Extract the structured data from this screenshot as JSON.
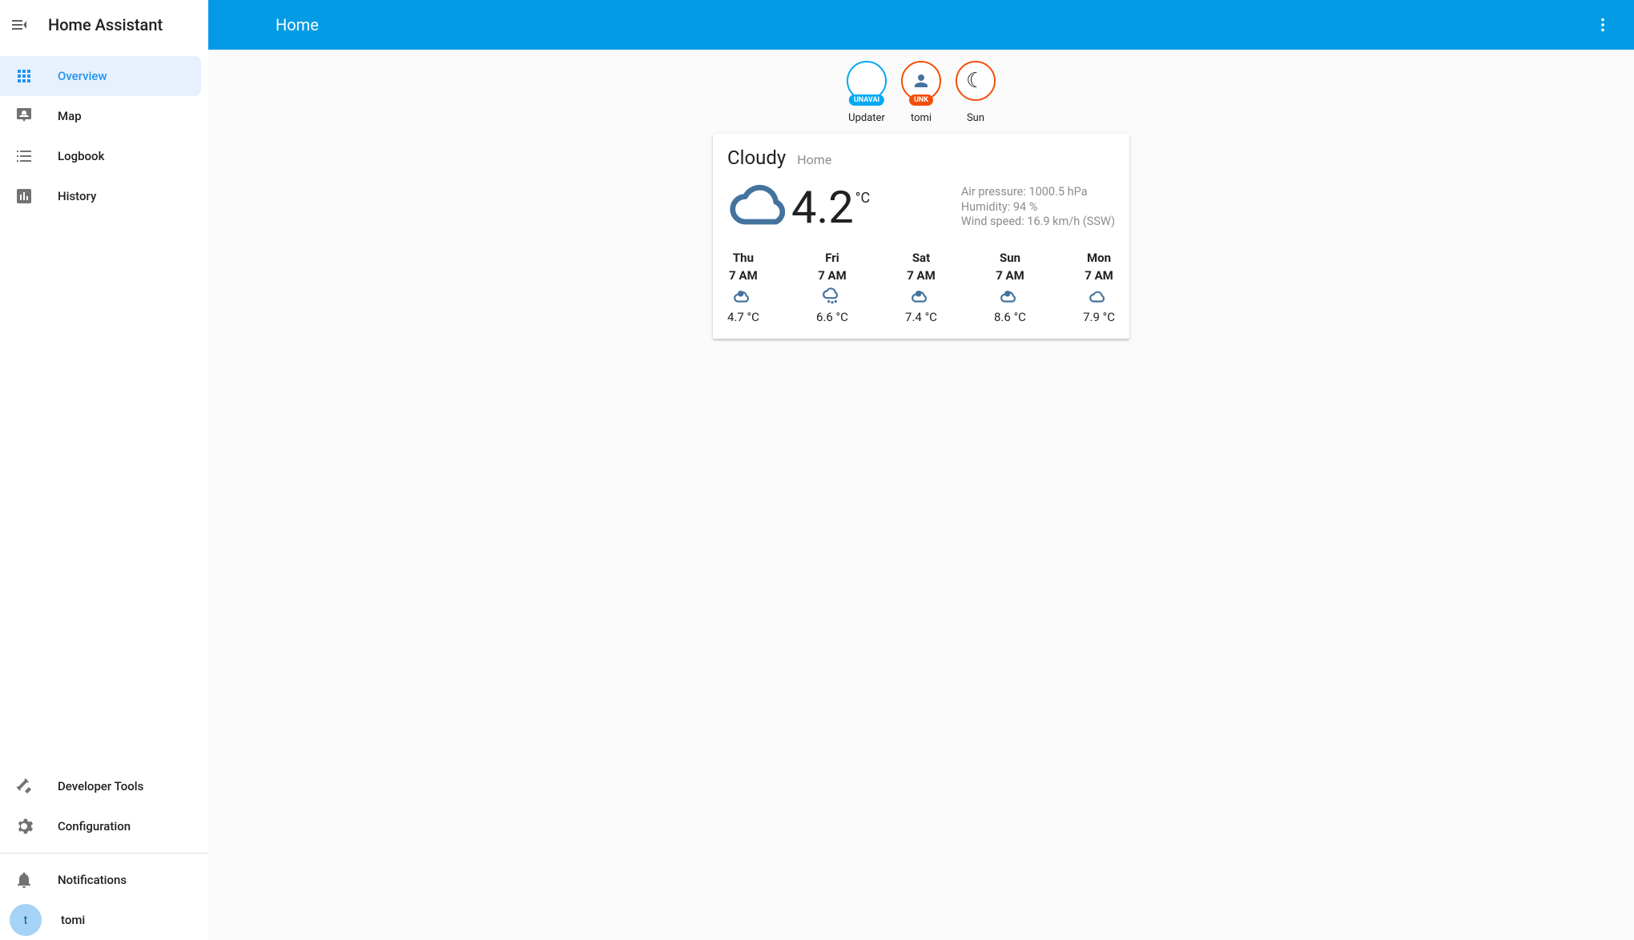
{
  "app": {
    "title": "Home Assistant"
  },
  "sidebar": {
    "items": [
      {
        "id": "overview",
        "label": "Overview",
        "active": true
      },
      {
        "id": "map",
        "label": "Map"
      },
      {
        "id": "logbook",
        "label": "Logbook"
      },
      {
        "id": "history",
        "label": "History"
      }
    ],
    "bottom": [
      {
        "id": "devtools",
        "label": "Developer Tools"
      },
      {
        "id": "config",
        "label": "Configuration"
      }
    ],
    "notifications_label": "Notifications",
    "user": {
      "name": "tomi",
      "initial": "t"
    }
  },
  "topbar": {
    "title": "Home"
  },
  "badges": [
    {
      "id": "updater",
      "label": "Updater",
      "pill": "UNAVAI",
      "pill_color": "blue",
      "ring": "blue",
      "icon": ""
    },
    {
      "id": "tomi",
      "label": "tomi",
      "pill": "UNK",
      "pill_color": "orange",
      "ring": "orange",
      "icon": "person"
    },
    {
      "id": "sun",
      "label": "Sun",
      "pill": "",
      "pill_color": "",
      "ring": "orange",
      "icon": "moon"
    }
  ],
  "weather": {
    "condition": "Cloudy",
    "location": "Home",
    "temp": "4.2",
    "temp_unit": "°C",
    "attrs": {
      "pressure_label": "Air pressure",
      "pressure_value": "1000.5 hPa",
      "humidity_label": "Humidity",
      "humidity_value": "94 %",
      "wind_label": "Wind speed",
      "wind_value": "16.9 km/h (SSW)"
    },
    "forecast": [
      {
        "day": "Thu",
        "time": "7 AM",
        "icon": "partly",
        "temp": "4.7 °C"
      },
      {
        "day": "Fri",
        "time": "7 AM",
        "icon": "rainy",
        "temp": "6.6 °C"
      },
      {
        "day": "Sat",
        "time": "7 AM",
        "icon": "partly",
        "temp": "7.4 °C"
      },
      {
        "day": "Sun",
        "time": "7 AM",
        "icon": "partly",
        "temp": "8.6 °C"
      },
      {
        "day": "Mon",
        "time": "7 AM",
        "icon": "cloudy",
        "temp": "7.9 °C"
      }
    ]
  }
}
